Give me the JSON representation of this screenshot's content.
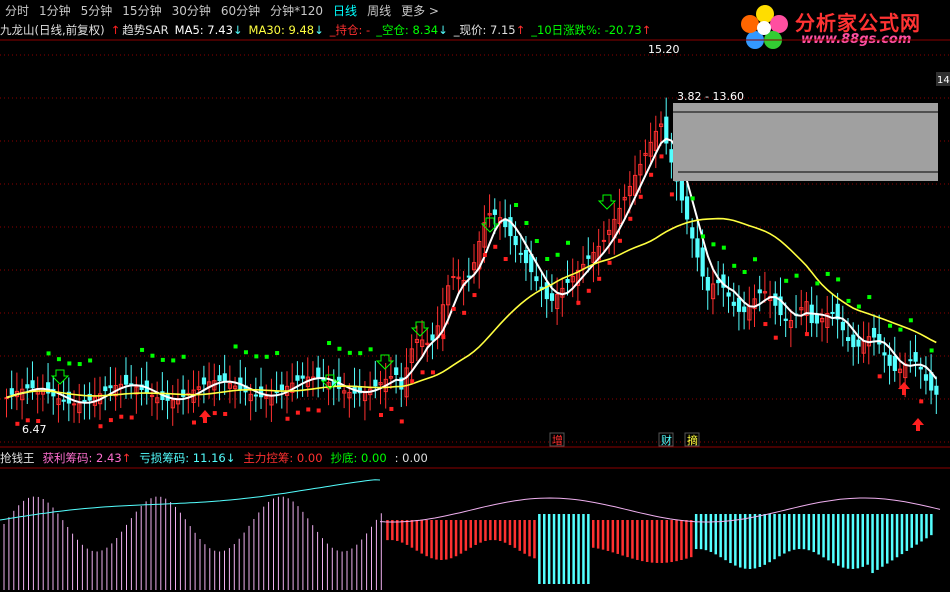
{
  "tabs": [
    "分时",
    "1分钟",
    "5分钟",
    "15分钟",
    "30分钟",
    "60分钟",
    "分钟*120",
    "日线",
    "周线",
    "更多 >"
  ],
  "active_tab": "日线",
  "header": {
    "title": "九龙山(日线,前复权)",
    "sar_label": "趋势SAR",
    "ma5": "MA5: 7.43",
    "ma30": "MA30: 9.48",
    "chicang": "_持仓: -",
    "kongcang": "_空仓: 8.34",
    "xianjia": "_现价: 7.15",
    "zhangdie": "_10日涨跌%: -20.73"
  },
  "logo": {
    "title": "分析家公式网",
    "url": "www.88gs.com"
  },
  "price_annotations": {
    "high": "15.20",
    "box_label": "3.82 - 13.60",
    "low": "6.47",
    "right_tag": "14"
  },
  "event_tags": [
    "增",
    "财",
    "摘"
  ],
  "indicator2": {
    "name": "抢钱王",
    "huoli": "获利筹码: 2.43",
    "kuisun": "亏损筹码: 11.16",
    "zhuli": "主力控筹: 0.00",
    "chaodi": "抄底: 0.00",
    "extra": ": 0.00"
  },
  "colors": {
    "up": "#ff3030",
    "down": "#54ffff",
    "ma_white": "#ffffff",
    "ma_yellow": "#ffff40",
    "sar_green": "#00ff00",
    "sar_red": "#ff2020",
    "grid": "#8b0000",
    "active_tab": "#00ffff"
  }
}
